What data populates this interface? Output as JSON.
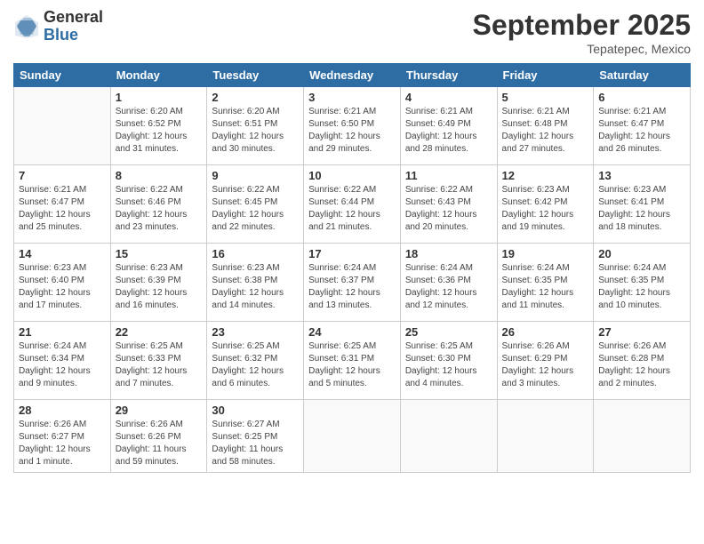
{
  "logo": {
    "general": "General",
    "blue": "Blue"
  },
  "header": {
    "title": "September 2025",
    "subtitle": "Tepatepec, Mexico"
  },
  "weekdays": [
    "Sunday",
    "Monday",
    "Tuesday",
    "Wednesday",
    "Thursday",
    "Friday",
    "Saturday"
  ],
  "weeks": [
    [
      {
        "day": "",
        "sunrise": "",
        "sunset": "",
        "daylight": ""
      },
      {
        "day": "1",
        "sunrise": "Sunrise: 6:20 AM",
        "sunset": "Sunset: 6:52 PM",
        "daylight": "Daylight: 12 hours and 31 minutes."
      },
      {
        "day": "2",
        "sunrise": "Sunrise: 6:20 AM",
        "sunset": "Sunset: 6:51 PM",
        "daylight": "Daylight: 12 hours and 30 minutes."
      },
      {
        "day": "3",
        "sunrise": "Sunrise: 6:21 AM",
        "sunset": "Sunset: 6:50 PM",
        "daylight": "Daylight: 12 hours and 29 minutes."
      },
      {
        "day": "4",
        "sunrise": "Sunrise: 6:21 AM",
        "sunset": "Sunset: 6:49 PM",
        "daylight": "Daylight: 12 hours and 28 minutes."
      },
      {
        "day": "5",
        "sunrise": "Sunrise: 6:21 AM",
        "sunset": "Sunset: 6:48 PM",
        "daylight": "Daylight: 12 hours and 27 minutes."
      },
      {
        "day": "6",
        "sunrise": "Sunrise: 6:21 AM",
        "sunset": "Sunset: 6:47 PM",
        "daylight": "Daylight: 12 hours and 26 minutes."
      }
    ],
    [
      {
        "day": "7",
        "sunrise": "Sunrise: 6:21 AM",
        "sunset": "Sunset: 6:47 PM",
        "daylight": "Daylight: 12 hours and 25 minutes."
      },
      {
        "day": "8",
        "sunrise": "Sunrise: 6:22 AM",
        "sunset": "Sunset: 6:46 PM",
        "daylight": "Daylight: 12 hours and 23 minutes."
      },
      {
        "day": "9",
        "sunrise": "Sunrise: 6:22 AM",
        "sunset": "Sunset: 6:45 PM",
        "daylight": "Daylight: 12 hours and 22 minutes."
      },
      {
        "day": "10",
        "sunrise": "Sunrise: 6:22 AM",
        "sunset": "Sunset: 6:44 PM",
        "daylight": "Daylight: 12 hours and 21 minutes."
      },
      {
        "day": "11",
        "sunrise": "Sunrise: 6:22 AM",
        "sunset": "Sunset: 6:43 PM",
        "daylight": "Daylight: 12 hours and 20 minutes."
      },
      {
        "day": "12",
        "sunrise": "Sunrise: 6:23 AM",
        "sunset": "Sunset: 6:42 PM",
        "daylight": "Daylight: 12 hours and 19 minutes."
      },
      {
        "day": "13",
        "sunrise": "Sunrise: 6:23 AM",
        "sunset": "Sunset: 6:41 PM",
        "daylight": "Daylight: 12 hours and 18 minutes."
      }
    ],
    [
      {
        "day": "14",
        "sunrise": "Sunrise: 6:23 AM",
        "sunset": "Sunset: 6:40 PM",
        "daylight": "Daylight: 12 hours and 17 minutes."
      },
      {
        "day": "15",
        "sunrise": "Sunrise: 6:23 AM",
        "sunset": "Sunset: 6:39 PM",
        "daylight": "Daylight: 12 hours and 16 minutes."
      },
      {
        "day": "16",
        "sunrise": "Sunrise: 6:23 AM",
        "sunset": "Sunset: 6:38 PM",
        "daylight": "Daylight: 12 hours and 14 minutes."
      },
      {
        "day": "17",
        "sunrise": "Sunrise: 6:24 AM",
        "sunset": "Sunset: 6:37 PM",
        "daylight": "Daylight: 12 hours and 13 minutes."
      },
      {
        "day": "18",
        "sunrise": "Sunrise: 6:24 AM",
        "sunset": "Sunset: 6:36 PM",
        "daylight": "Daylight: 12 hours and 12 minutes."
      },
      {
        "day": "19",
        "sunrise": "Sunrise: 6:24 AM",
        "sunset": "Sunset: 6:35 PM",
        "daylight": "Daylight: 12 hours and 11 minutes."
      },
      {
        "day": "20",
        "sunrise": "Sunrise: 6:24 AM",
        "sunset": "Sunset: 6:35 PM",
        "daylight": "Daylight: 12 hours and 10 minutes."
      }
    ],
    [
      {
        "day": "21",
        "sunrise": "Sunrise: 6:24 AM",
        "sunset": "Sunset: 6:34 PM",
        "daylight": "Daylight: 12 hours and 9 minutes."
      },
      {
        "day": "22",
        "sunrise": "Sunrise: 6:25 AM",
        "sunset": "Sunset: 6:33 PM",
        "daylight": "Daylight: 12 hours and 7 minutes."
      },
      {
        "day": "23",
        "sunrise": "Sunrise: 6:25 AM",
        "sunset": "Sunset: 6:32 PM",
        "daylight": "Daylight: 12 hours and 6 minutes."
      },
      {
        "day": "24",
        "sunrise": "Sunrise: 6:25 AM",
        "sunset": "Sunset: 6:31 PM",
        "daylight": "Daylight: 12 hours and 5 minutes."
      },
      {
        "day": "25",
        "sunrise": "Sunrise: 6:25 AM",
        "sunset": "Sunset: 6:30 PM",
        "daylight": "Daylight: 12 hours and 4 minutes."
      },
      {
        "day": "26",
        "sunrise": "Sunrise: 6:26 AM",
        "sunset": "Sunset: 6:29 PM",
        "daylight": "Daylight: 12 hours and 3 minutes."
      },
      {
        "day": "27",
        "sunrise": "Sunrise: 6:26 AM",
        "sunset": "Sunset: 6:28 PM",
        "daylight": "Daylight: 12 hours and 2 minutes."
      }
    ],
    [
      {
        "day": "28",
        "sunrise": "Sunrise: 6:26 AM",
        "sunset": "Sunset: 6:27 PM",
        "daylight": "Daylight: 12 hours and 1 minute."
      },
      {
        "day": "29",
        "sunrise": "Sunrise: 6:26 AM",
        "sunset": "Sunset: 6:26 PM",
        "daylight": "Daylight: 11 hours and 59 minutes."
      },
      {
        "day": "30",
        "sunrise": "Sunrise: 6:27 AM",
        "sunset": "Sunset: 6:25 PM",
        "daylight": "Daylight: 11 hours and 58 minutes."
      },
      {
        "day": "",
        "sunrise": "",
        "sunset": "",
        "daylight": ""
      },
      {
        "day": "",
        "sunrise": "",
        "sunset": "",
        "daylight": ""
      },
      {
        "day": "",
        "sunrise": "",
        "sunset": "",
        "daylight": ""
      },
      {
        "day": "",
        "sunrise": "",
        "sunset": "",
        "daylight": ""
      }
    ]
  ]
}
